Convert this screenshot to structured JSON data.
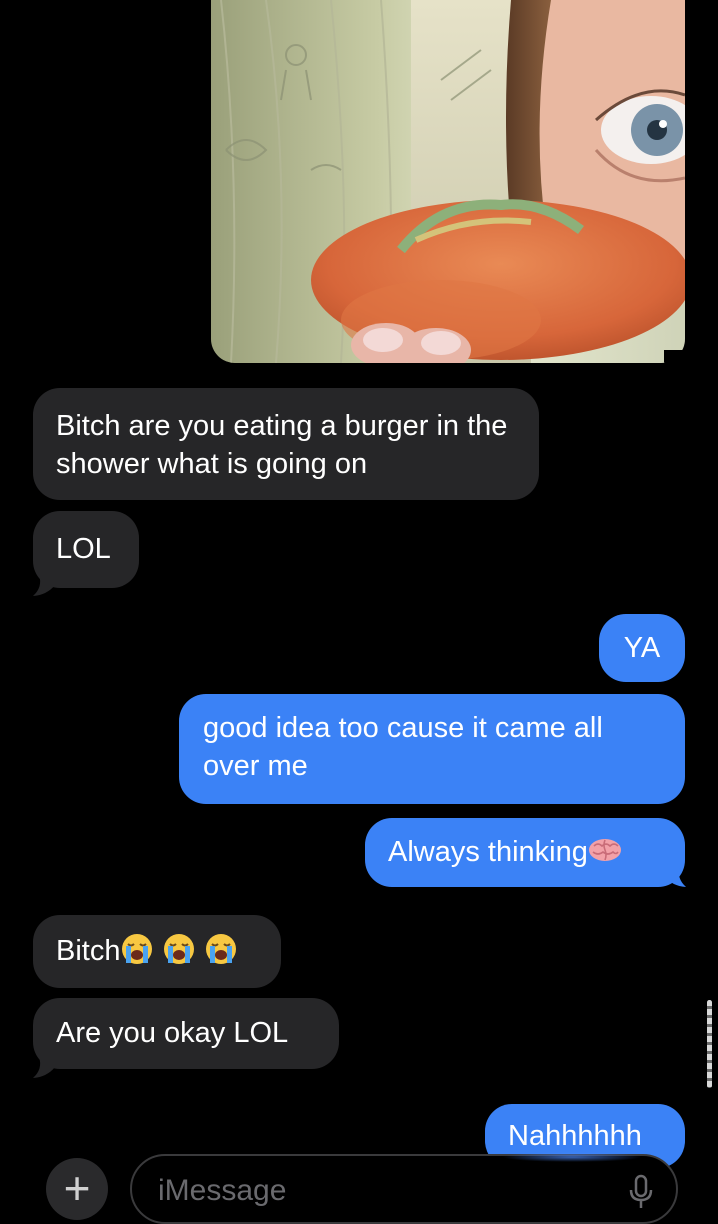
{
  "messages": [
    {
      "side": "incoming",
      "text": "Bitch are you eating a burger in the shower what is going on"
    },
    {
      "side": "incoming",
      "text": "LOL"
    },
    {
      "side": "outgoing",
      "text": "YA"
    },
    {
      "side": "outgoing",
      "text": "good idea too cause it came all over me"
    },
    {
      "side": "outgoing",
      "text": "Always thinking"
    },
    {
      "side": "incoming",
      "text": "Bitch"
    },
    {
      "side": "incoming",
      "text": "Are you okay LOL"
    },
    {
      "side": "outgoing",
      "text": "Nahhhhhh"
    }
  ],
  "compose": {
    "plus_symbol": "+",
    "placeholder": "iMessage"
  },
  "colors": {
    "background": "#000000",
    "incoming_bubble": "#262628",
    "outgoing_bubble": "#3b82f6",
    "text": "#ffffff"
  },
  "icons": {
    "brain": "brain-emoji",
    "crying": "loudly-crying-face-emoji",
    "mic": "microphone-icon",
    "plus": "plus-icon"
  }
}
